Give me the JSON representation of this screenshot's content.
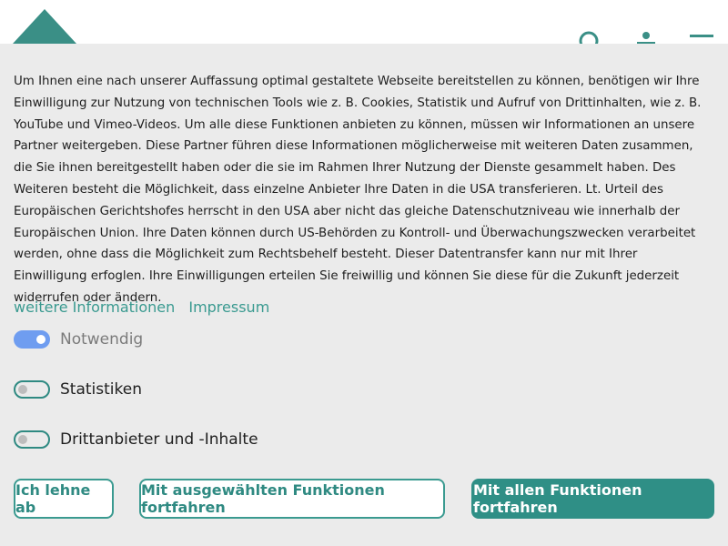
{
  "header": {
    "logo_icon": "teal-triangle-logo",
    "icons": [
      "search-icon",
      "user-icon",
      "menu-icon"
    ],
    "accent_color": "#3a8f86"
  },
  "consent": {
    "text": "Um Ihnen eine nach unserer Auffassung optimal gestaltete Webseite bereitstellen zu können, benötigen wir Ihre Einwilligung zur Nutzung von technischen Tools wie z. B. Cookies, Statistik und Aufruf von Drittinhalten, wie z. B. YouTube und Vimeo-Videos. Um alle diese Funktionen anbieten zu können, müssen wir Informationen an unsere Partner weitergeben. Diese Partner führen diese Informationen möglicherweise mit weiteren Daten zusammen, die Sie ihnen bereitgestellt haben oder die sie im Rahmen Ihrer Nutzung der Dienste gesammelt haben. Des Weiteren besteht die Möglichkeit, dass einzelne Anbieter Ihre Daten in die USA transferieren. Lt. Urteil des Europäischen Gerichtshofes herrscht in den USA aber nicht das gleiche Datenschutzniveau wie innerhalb der Europäischen Union. Ihre Daten können durch US-Behörden zu Kontroll- und Überwachungszwecken verarbeitet werden, ohne dass die Möglichkeit zum Rechtsbehelf besteht. Dieser Datentransfer kann nur mit Ihrer Einwilligung erfoglen. Ihre Einwilligungen erteilen Sie freiwillig und können Sie diese für die Zukunft jederzeit widerrufen oder ändern.",
    "links": {
      "more_info": "weitere Informationen",
      "imprint": "Impressum"
    },
    "toggles": [
      {
        "label": "Notwendig",
        "on": true,
        "disabled": true
      },
      {
        "label": "Statistiken",
        "on": false,
        "disabled": false
      },
      {
        "label": "Drittanbieter und -Inhalte",
        "on": false,
        "disabled": false
      }
    ],
    "buttons": {
      "reject": "Ich lehne ab",
      "selected": "Mit ausgewählten Funktionen fortfahren",
      "all": "Mit allen Funktionen fortfahren"
    }
  }
}
